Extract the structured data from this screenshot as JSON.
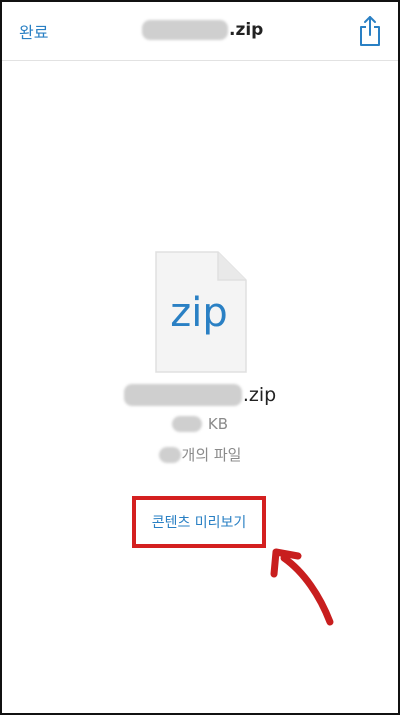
{
  "nav": {
    "done_label": "완료",
    "title_suffix": ".zip"
  },
  "file": {
    "type_label": "zip",
    "name_suffix": ".zip",
    "size_unit": "KB",
    "count_suffix": "개의 파일"
  },
  "actions": {
    "preview_label": "콘텐츠 미리보기"
  },
  "colors": {
    "accent": "#2a80c4",
    "annotation": "#d42020"
  },
  "icons": {
    "share": "share-icon",
    "file": "zip-file-icon",
    "annotation": "red-arrow-icon"
  }
}
